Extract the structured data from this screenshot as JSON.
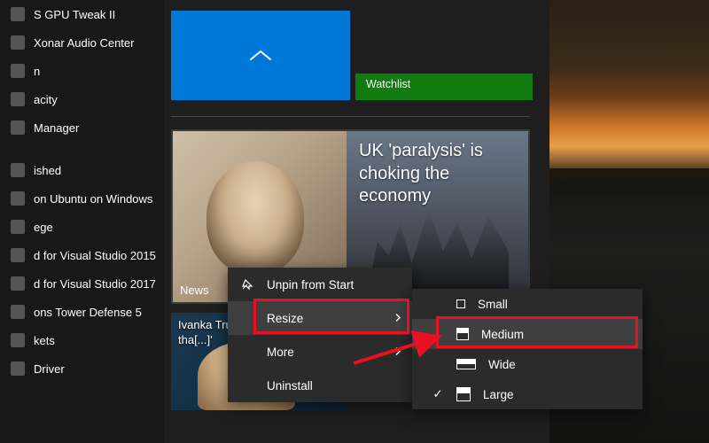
{
  "app_list": [
    "S GPU Tweak II",
    "Xonar Audio Center",
    "n",
    "acity",
    "Manager",
    "ished",
    "on Ubuntu on Windows",
    "ege",
    "d for Visual Studio 2015",
    "d for Visual Studio 2017",
    "ons Tower Defense 5",
    "kets",
    "Driver"
  ],
  "tiles": {
    "watchlist_label": "Watchlist",
    "news": {
      "label": "News",
      "headline": "UK 'paralysis' is choking the economy"
    },
    "secondary": {
      "headline": "Ivanka Trump: '[...] viciousness tha[...]'"
    }
  },
  "context_menu": {
    "unpin": "Unpin from Start",
    "resize": "Resize",
    "more": "More",
    "uninstall": "Uninstall"
  },
  "resize_submenu": {
    "small": "Small",
    "medium": "Medium",
    "wide": "Wide",
    "large": "Large",
    "current": "large"
  },
  "annotation": {
    "highlight_menu_item": "resize",
    "highlight_submenu_item": "medium"
  }
}
